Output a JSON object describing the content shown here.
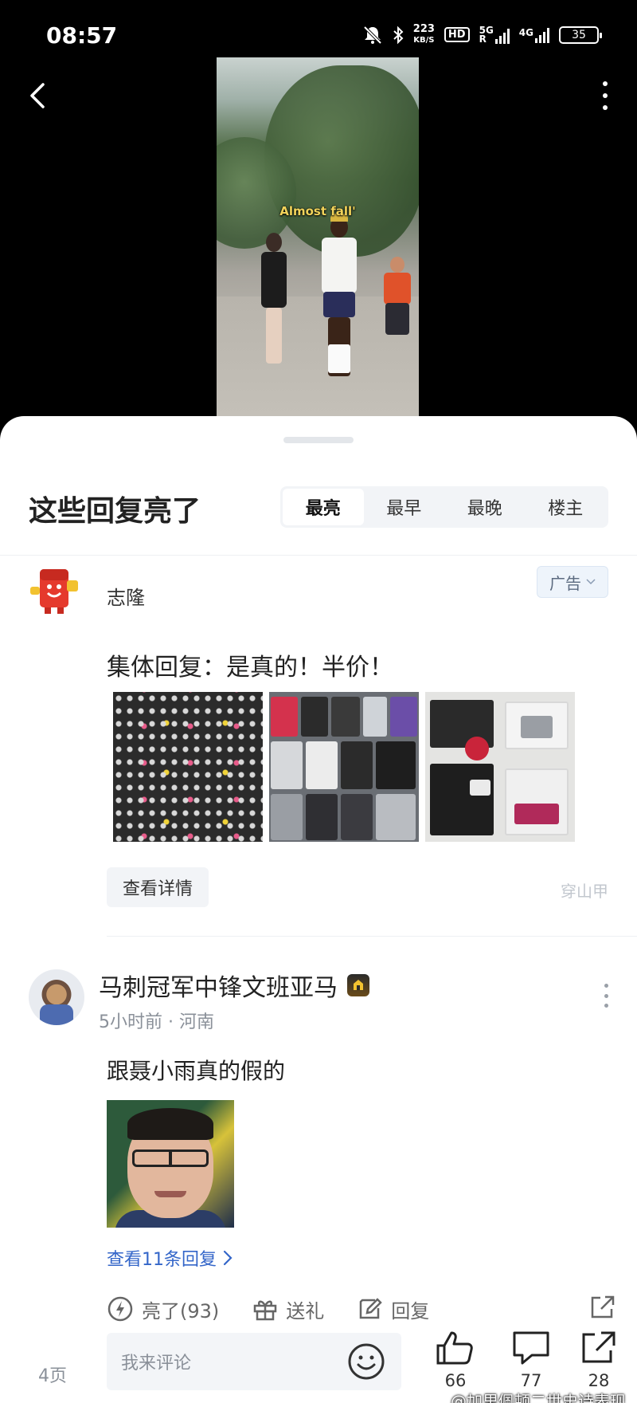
{
  "status_bar": {
    "time": "08:57",
    "net_speed_value": "223",
    "net_speed_unit": "KB/S",
    "hd_label": "HD",
    "signal1": "5G",
    "signal1_sub": "R",
    "signal2": "4G",
    "battery": "35"
  },
  "video": {
    "caption": "Almost fall'"
  },
  "replies": {
    "title": "这些回复亮了",
    "tabs": [
      {
        "label": "最亮",
        "active": true
      },
      {
        "label": "最早",
        "active": false
      },
      {
        "label": "最晚",
        "active": false
      },
      {
        "label": "楼主",
        "active": false
      }
    ]
  },
  "ad": {
    "name": "志隆",
    "tag": "广告",
    "text": "集体回复：是真的！半价！",
    "detail_label": "查看详情",
    "source": "穿山甲"
  },
  "comment": {
    "author": "马刺冠军中锋文班亚马",
    "meta": "5小时前 · 河南",
    "text": "跟聂小雨真的假的",
    "replies_link": "查看11条回复",
    "actions": {
      "light": "亮了(93)",
      "gift": "送礼",
      "reply": "回复"
    }
  },
  "bottom_bar": {
    "page": "4页",
    "input_placeholder": "我来评论",
    "likes": "66",
    "comments": "77",
    "shares": "28"
  },
  "watermark": "@加里佩顿二世史诗表现",
  "colors": {
    "link_blue": "#3466c9",
    "ad_tag_bg": "#eef4fb",
    "tab_bg": "#f2f4f7"
  }
}
